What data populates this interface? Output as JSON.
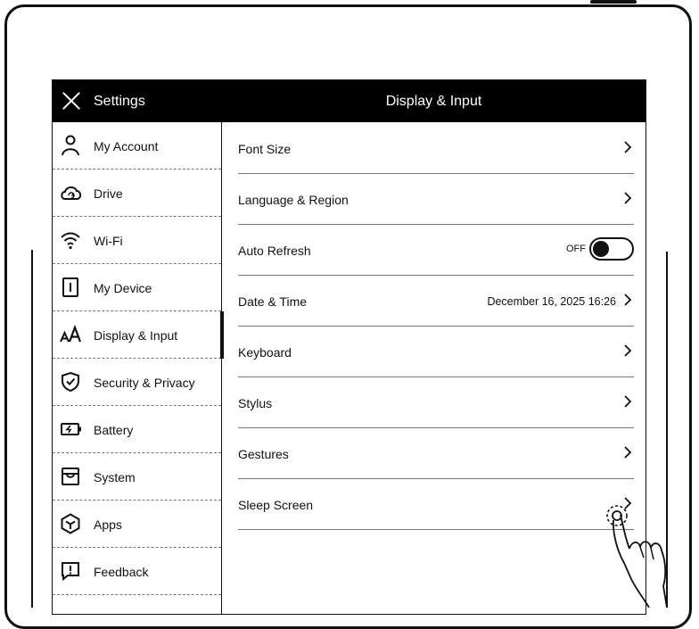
{
  "header": {
    "settings_title": "Settings",
    "panel_title": "Display & Input"
  },
  "sidebar": {
    "items": [
      {
        "label": "My Account",
        "icon": "person-icon"
      },
      {
        "label": "Drive",
        "icon": "cloud-sync-icon"
      },
      {
        "label": "Wi-Fi",
        "icon": "wifi-icon"
      },
      {
        "label": "My Device",
        "icon": "device-icon"
      },
      {
        "label": "Display & Input",
        "icon": "font-size-icon",
        "active": true
      },
      {
        "label": "Security & Privacy",
        "icon": "shield-check-icon"
      },
      {
        "label": "Battery",
        "icon": "battery-icon"
      },
      {
        "label": "System",
        "icon": "system-icon"
      },
      {
        "label": "Apps",
        "icon": "apps-icon"
      },
      {
        "label": "Feedback",
        "icon": "feedback-icon"
      }
    ]
  },
  "main": {
    "rows": [
      {
        "label": "Font Size"
      },
      {
        "label": "Language & Region"
      },
      {
        "label": "Auto Refresh",
        "toggle": "OFF"
      },
      {
        "label": "Date & Time",
        "value": "December 16, 2025 16:26"
      },
      {
        "label": "Keyboard"
      },
      {
        "label": "Stylus"
      },
      {
        "label": "Gestures"
      },
      {
        "label": "Sleep Screen"
      }
    ]
  },
  "annotation": {
    "icon": "tap-hand-icon"
  }
}
